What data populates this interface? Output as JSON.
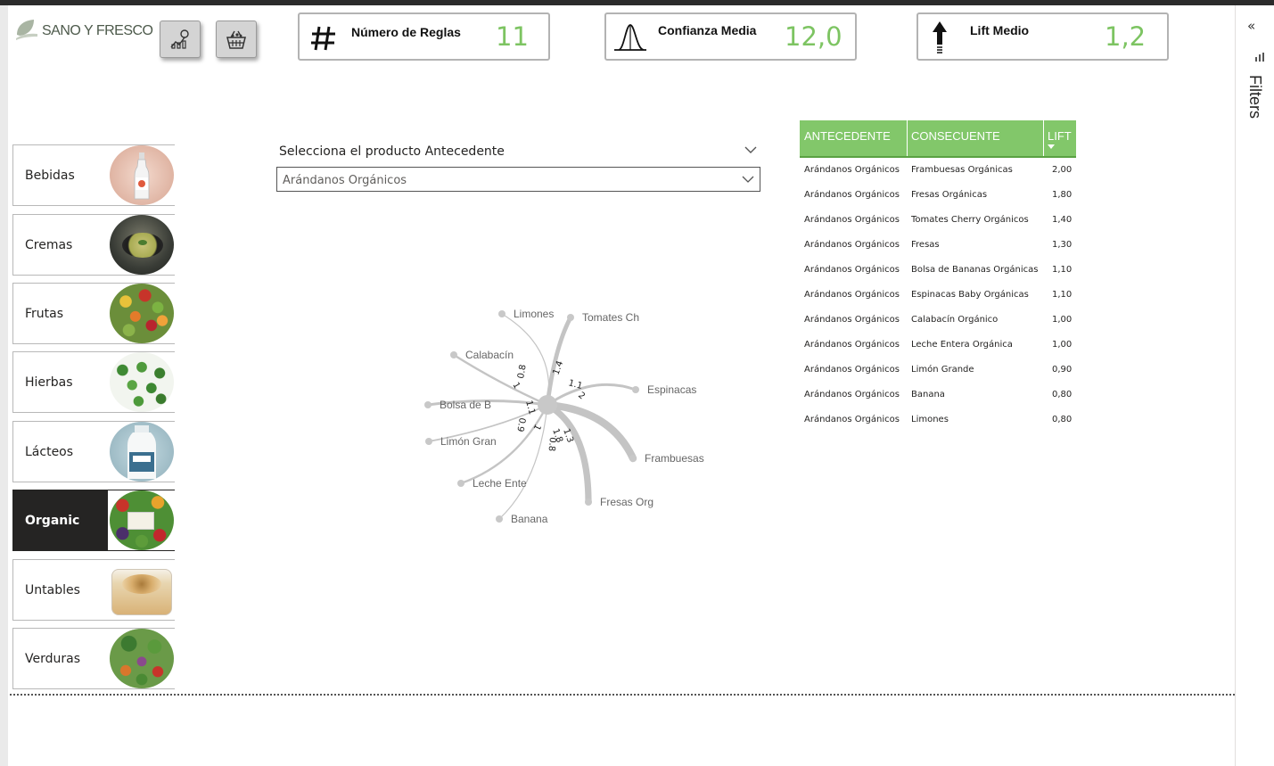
{
  "brand": {
    "name": "SANO Y FRESCO"
  },
  "nav_buttons": [
    {
      "icon": "analytics-chart-icon"
    },
    {
      "icon": "shopping-basket-icon"
    }
  ],
  "kpis": [
    {
      "icon": "hash-icon",
      "title": "Número de Reglas",
      "value": "11"
    },
    {
      "icon": "bell-curve-icon",
      "title": "Confianza Media",
      "value": "12,0"
    },
    {
      "icon": "up-arrow-icon",
      "title": "Lift Medio",
      "value": "1,2"
    }
  ],
  "categories": [
    {
      "label": "Bebidas",
      "active": false
    },
    {
      "label": "Cremas",
      "active": false
    },
    {
      "label": "Frutas",
      "active": false
    },
    {
      "label": "Hierbas",
      "active": false
    },
    {
      "label": "Lácteos",
      "active": false
    },
    {
      "label": "Organic",
      "active": true
    },
    {
      "label": "Untables",
      "active": false
    },
    {
      "label": "Verduras",
      "active": false
    }
  ],
  "slicer": {
    "title": "Selecciona el producto Antecedente",
    "value": "Arándanos Orgánicos"
  },
  "network": {
    "edges": [
      {
        "target": "Limones",
        "weight": "0.8"
      },
      {
        "target": "Tomates Ch",
        "weight": "1.4"
      },
      {
        "target": "Calabacín",
        "weight": "1"
      },
      {
        "target": "Espinacas",
        "weight": "1.1"
      },
      {
        "target": "Bolsa de B",
        "weight": "1.1"
      },
      {
        "target": "Frambuesas",
        "weight": "2"
      },
      {
        "target": "Limón Gran",
        "weight": "0.9"
      },
      {
        "target": "Fresas Org",
        "weight": "1.8"
      },
      {
        "target": "Leche Ente",
        "weight": "1"
      },
      {
        "target": "Banana",
        "weight": "0.8"
      }
    ],
    "extra_labels": [
      "1.3"
    ]
  },
  "table": {
    "headers": [
      "ANTECEDENTE",
      "CONSECUENTE",
      "LIFT"
    ],
    "rows": [
      [
        "Arándanos Orgánicos",
        "Frambuesas Orgánicas",
        "2,00"
      ],
      [
        "Arándanos Orgánicos",
        "Fresas Orgánicas",
        "1,80"
      ],
      [
        "Arándanos Orgánicos",
        "Tomates Cherry Orgánicos",
        "1,40"
      ],
      [
        "Arándanos Orgánicos",
        "Fresas",
        "1,30"
      ],
      [
        "Arándanos Orgánicos",
        "Bolsa de Bananas Orgánicas",
        "1,10"
      ],
      [
        "Arándanos Orgánicos",
        "Espinacas Baby Orgánicas",
        "1,10"
      ],
      [
        "Arándanos Orgánicos",
        "Calabacín Orgánico",
        "1,00"
      ],
      [
        "Arándanos Orgánicos",
        "Leche Entera Orgánica",
        "1,00"
      ],
      [
        "Arándanos Orgánicos",
        "Limón Grande",
        "0,90"
      ],
      [
        "Arándanos Orgánicos",
        "Banana",
        "0,80"
      ],
      [
        "Arándanos Orgánicos",
        "Limones",
        "0,80"
      ]
    ]
  },
  "filters_pane": {
    "label": "Filters",
    "collapse_icon": "double-chevron-left-icon"
  },
  "colors": {
    "accent": "#7dc462",
    "header": "#82c76a",
    "active_nav": "#252423"
  }
}
